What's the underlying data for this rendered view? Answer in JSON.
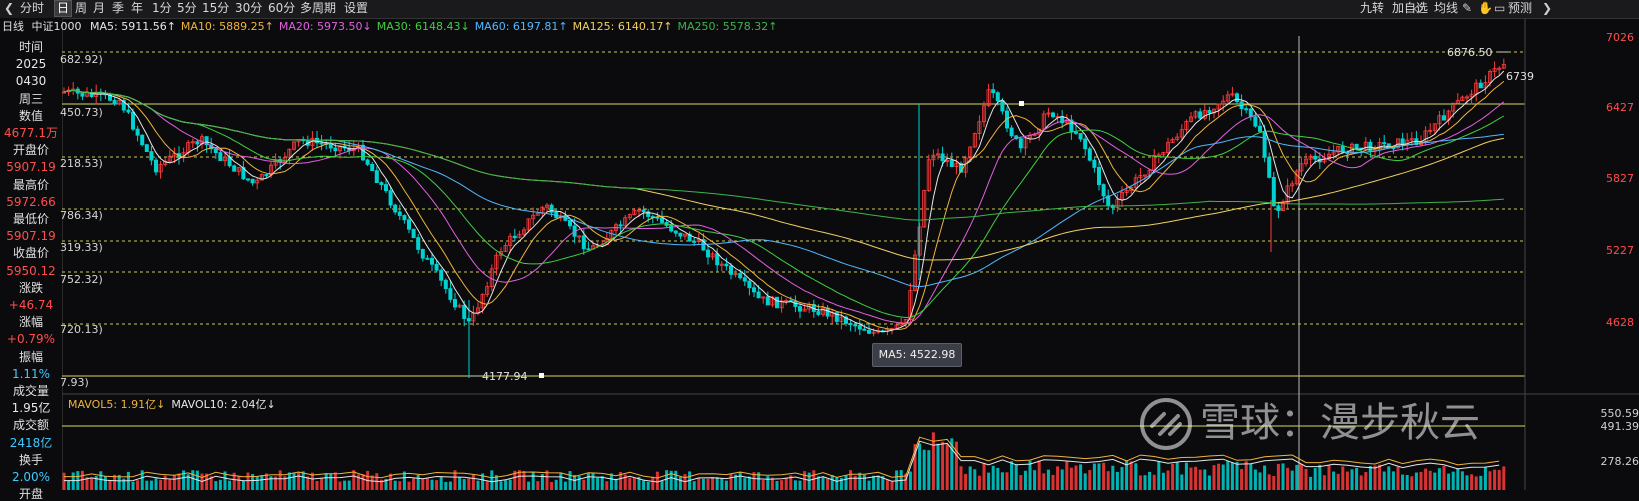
{
  "toolbar": {
    "buttons": [
      {
        "label": "分时",
        "active": false
      },
      {
        "label": "日",
        "active": true
      },
      {
        "label": "周",
        "active": false
      },
      {
        "label": "月",
        "active": false
      },
      {
        "label": "季",
        "active": false
      },
      {
        "label": "年",
        "active": false
      },
      {
        "label": "1分",
        "active": false
      },
      {
        "label": "5分",
        "active": false
      },
      {
        "label": "15分",
        "active": false
      },
      {
        "label": "30分",
        "active": false
      },
      {
        "label": "60分",
        "active": false
      },
      {
        "label": "多周期",
        "active": false
      },
      {
        "label": "设置",
        "active": false
      }
    ],
    "right": [
      "九转",
      "加自选",
      "均线",
      "预测"
    ]
  },
  "sidebar": [
    {
      "text": "时间",
      "style": "label"
    },
    {
      "text": "2025",
      "style": "white"
    },
    {
      "text": "0430",
      "style": "white"
    },
    {
      "text": "周三",
      "style": "label"
    },
    {
      "text": "数值",
      "style": "label"
    },
    {
      "text": "4677.1万",
      "style": "red"
    },
    {
      "text": "开盘价",
      "style": "label"
    },
    {
      "text": "5907.19",
      "style": "red"
    },
    {
      "text": "最高价",
      "style": "label"
    },
    {
      "text": "5972.66",
      "style": "red"
    },
    {
      "text": "最低价",
      "style": "label"
    },
    {
      "text": "5907.19",
      "style": "red"
    },
    {
      "text": "收盘价",
      "style": "label"
    },
    {
      "text": "5950.12",
      "style": "red"
    },
    {
      "text": "涨跌",
      "style": "label"
    },
    {
      "text": "+46.74",
      "style": "red"
    },
    {
      "text": "涨幅",
      "style": "label"
    },
    {
      "text": "+0.79%",
      "style": "red"
    },
    {
      "text": "振幅",
      "style": "label"
    },
    {
      "text": "1.11%",
      "style": "cyan"
    },
    {
      "text": "成交量",
      "style": "label"
    },
    {
      "text": "1.95亿",
      "style": "white"
    },
    {
      "text": "成交额",
      "style": "label"
    },
    {
      "text": "2418亿",
      "style": "cyan"
    },
    {
      "text": "换手",
      "style": "label"
    },
    {
      "text": "2.00%",
      "style": "cyan"
    },
    {
      "text": "开盘",
      "style": "label"
    }
  ],
  "header": {
    "period": "日线",
    "index_name": "中证1000",
    "ma": [
      {
        "label": "MA5: 5911.56",
        "color": "#e6e6e6",
        "arrow": "↑"
      },
      {
        "label": "MA10: 5889.25",
        "color": "#f0b43c",
        "arrow": "↑"
      },
      {
        "label": "MA20: 5973.50",
        "color": "#e060e0",
        "arrow": "↓"
      },
      {
        "label": "MA30: 6148.43",
        "color": "#40d040",
        "arrow": "↓"
      },
      {
        "label": "MA60: 6197.81",
        "color": "#50b8ff",
        "arrow": "↑"
      },
      {
        "label": "MA125: 6140.17",
        "color": "#f0d060",
        "arrow": "↑"
      },
      {
        "label": "MA250: 5578.32",
        "color": "#3cb44b",
        "arrow": "↑"
      }
    ]
  },
  "right_axis": [
    "7026",
    "6427",
    "5827",
    "5227",
    "4628"
  ],
  "left_prices": [
    "682.92)",
    "450.73)",
    "218.53)",
    "786.34)",
    "319.33)",
    "752.32)",
    "720.13)",
    "7.93)"
  ],
  "annotations": {
    "high": "6876.50",
    "partial": "6739",
    "low": "4177.94",
    "tooltip": "MA5: 4522.98"
  },
  "volume": {
    "items": [
      {
        "label": "MAVOL5: 1.91亿",
        "color": "#f0b43c",
        "arrow": "↓"
      },
      {
        "label": "MAVOL10: 2.04亿",
        "color": "#e6e6e6",
        "arrow": "↓"
      }
    ],
    "axis": [
      "550.59",
      "491.39",
      "278.26"
    ]
  },
  "watermark": {
    "text": "雪球：漫步秋云"
  },
  "colors": {
    "up": "#ff3b3b",
    "down": "#00d2d2",
    "grid_dash": "#c9c955"
  }
}
